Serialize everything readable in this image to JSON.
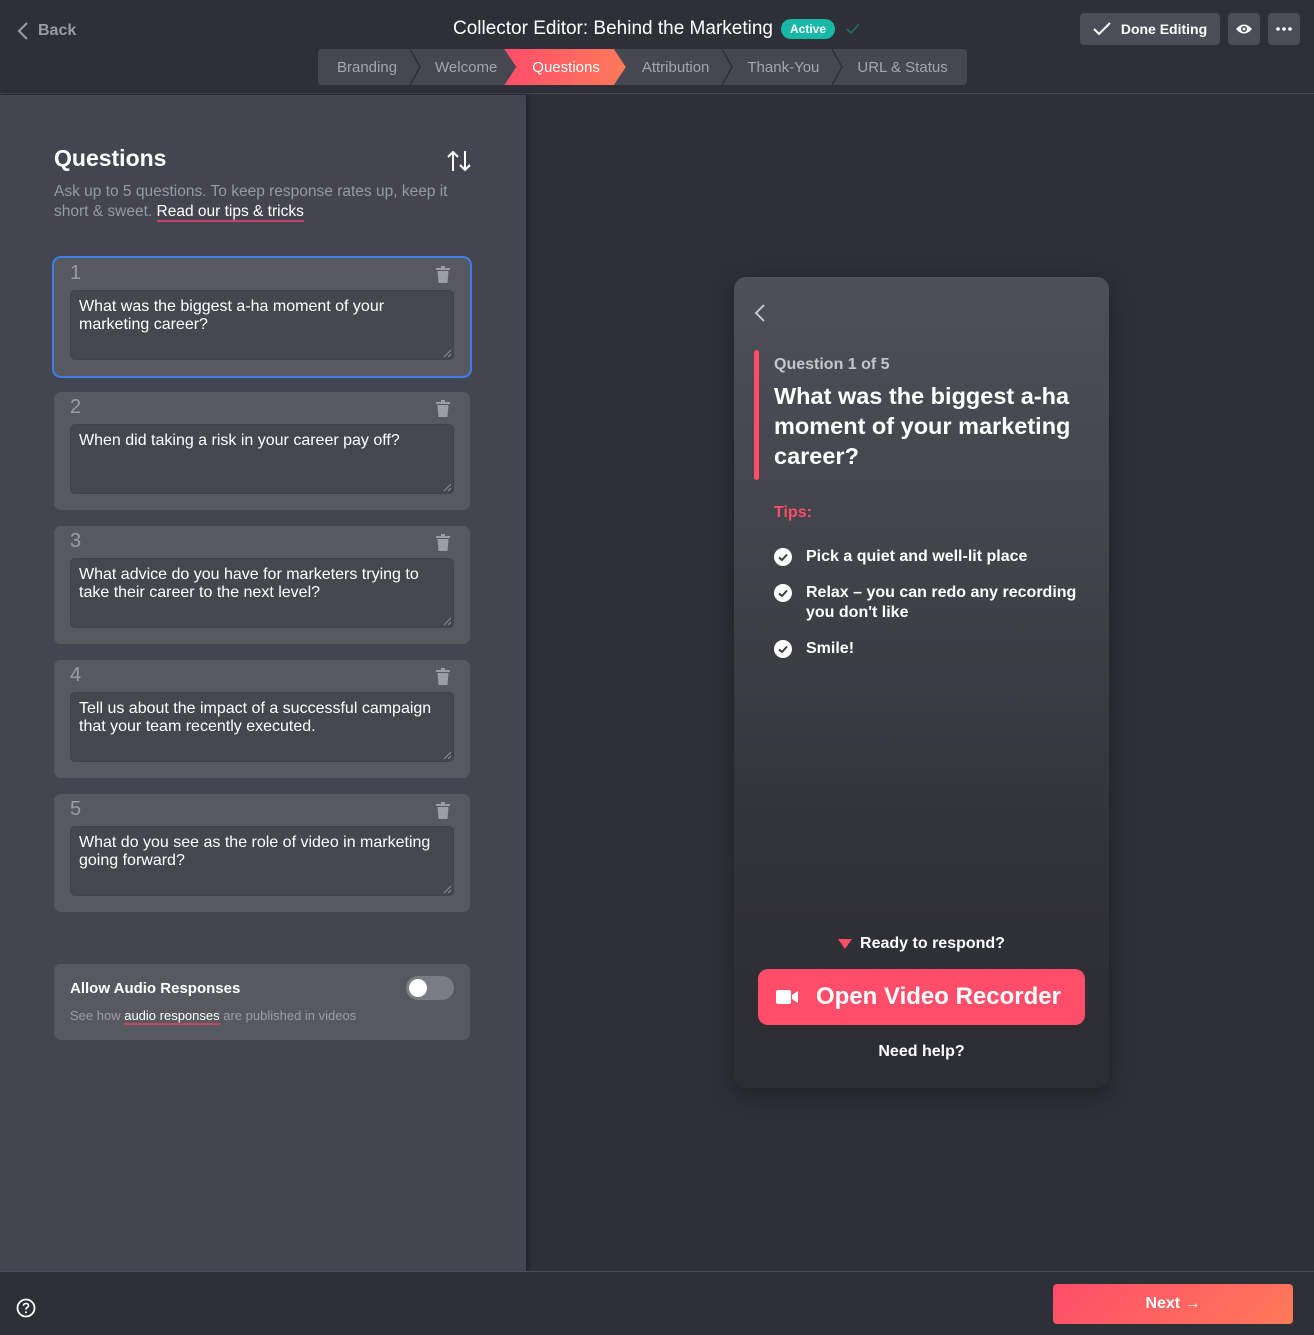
{
  "header": {
    "back_label": "Back",
    "title": "Collector Editor: Behind the Marketing",
    "status_badge": "Active",
    "done_label": "Done Editing",
    "steps": [
      {
        "label": "Branding",
        "active": false
      },
      {
        "label": "Welcome",
        "active": false
      },
      {
        "label": "Questions",
        "active": true
      },
      {
        "label": "Attribution",
        "active": false
      },
      {
        "label": "Thank-You",
        "active": false
      },
      {
        "label": "URL & Status",
        "active": false
      }
    ]
  },
  "questions_panel": {
    "heading": "Questions",
    "description": "Ask up to 5 questions. To keep response rates up, keep it short & sweet.",
    "tips_link": "Read our tips & tricks",
    "questions": [
      {
        "number": "1",
        "text": "What was the biggest a-ha moment of your marketing career?"
      },
      {
        "number": "2",
        "text": "When did taking a risk in your career pay off?"
      },
      {
        "number": "3",
        "text": "What advice do you have for marketers trying to take their career to the next level?"
      },
      {
        "number": "4",
        "text": "Tell us about the impact of a successful campaign that your team recently executed."
      },
      {
        "number": "5",
        "text": "What do you see as the role of video in marketing going forward?"
      }
    ],
    "audio": {
      "title": "Allow Audio Responses",
      "sub_prefix": "See how",
      "sub_link": "audio responses",
      "sub_suffix": "are published in videos",
      "enabled": false
    }
  },
  "preview": {
    "question_label": "Question 1 of 5",
    "question_title": "What was the biggest a-ha moment of your marketing career?",
    "tips_label": "Tips:",
    "tips": [
      "Pick a quiet and well-lit place",
      "Relax – you can redo any recording you don't like",
      "Smile!"
    ],
    "ready_label": "Ready to respond?",
    "record_button": "Open Video Recorder",
    "help_link": "Need help?"
  },
  "footer": {
    "next_label": "Next →"
  },
  "colors": {
    "accent": "#ff4d6a",
    "accent_gradient_end": "#ff7a58",
    "active_badge": "#17b8a6",
    "selected_outline": "#3c7fe9"
  }
}
